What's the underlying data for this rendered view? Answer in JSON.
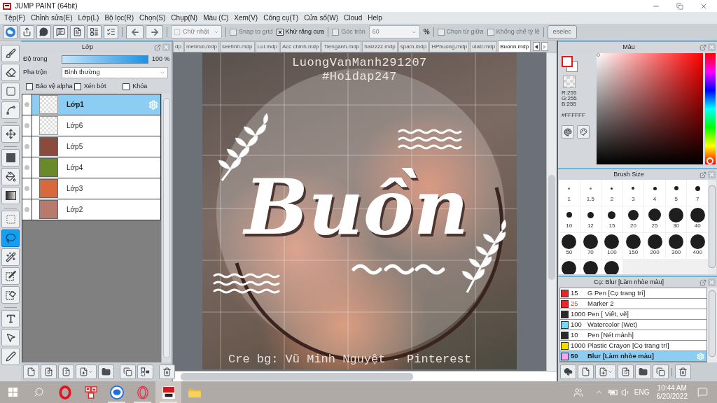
{
  "window": {
    "title": "JUMP PAINT (64bit)"
  },
  "menu": [
    "Tệp(F)",
    "Chỉnh sửa(E)",
    "Lớp(L)",
    "Bộ lọc(R)",
    "Chọn(S)",
    "Chụp(N)",
    "Màu (C)",
    "Xem(V)",
    "Công cụ(T)",
    "Cửa sổ(W)",
    "Cloud",
    "Help"
  ],
  "toolbar": {
    "button_groups": [
      [
        {
          "kind": "cloud"
        },
        {
          "kind": "share"
        },
        {
          "kind": "bubble"
        },
        {
          "kind": "comment"
        },
        {
          "kind": "document"
        },
        {
          "kind": "list"
        },
        {
          "kind": "checklist"
        }
      ],
      [
        {
          "kind": "undo"
        },
        {
          "kind": "redo"
        }
      ]
    ],
    "option_groups": [
      [
        {
          "kind": "shape-combo",
          "value": "Chữ nhật",
          "disabled": true
        }
      ],
      [
        {
          "kind": "checkbox",
          "label": "Snap to grid",
          "checked": false,
          "disabled": true
        },
        {
          "kind": "checkbox",
          "label": "Khử răng cưa",
          "checked": true,
          "disabled": false
        }
      ],
      [
        {
          "kind": "checkbox",
          "label": "Góc tròn",
          "checked": false,
          "disabled": true
        },
        {
          "kind": "combo",
          "value": "60",
          "disabled": true
        },
        {
          "kind": "text",
          "label": "%"
        }
      ],
      [
        {
          "kind": "checkbox",
          "label": "Chọn từ giữa",
          "checked": false,
          "disabled": true
        },
        {
          "kind": "checkbox",
          "label": "Khống chế tỷ lệ",
          "checked": false,
          "disabled": true
        }
      ],
      [
        {
          "kind": "button",
          "label": "eselec",
          "disabled": true
        }
      ]
    ]
  },
  "tool_groups": [
    [
      {
        "kind": "brush",
        "selected": false
      },
      {
        "kind": "eraser",
        "selected": false
      },
      {
        "kind": "rectangle",
        "selected": false
      },
      {
        "kind": "polyline",
        "selected": false
      }
    ],
    [
      {
        "kind": "move",
        "selected": false
      }
    ],
    [
      {
        "kind": "fill-rect",
        "selected": false
      },
      {
        "kind": "bucket",
        "selected": false
      },
      {
        "kind": "gradient",
        "selected": false
      }
    ],
    [
      {
        "kind": "rect-select",
        "selected": false
      },
      {
        "kind": "lasso",
        "selected": true
      },
      {
        "kind": "wand",
        "selected": false
      },
      {
        "kind": "select-pen",
        "selected": false
      },
      {
        "kind": "select-eraser",
        "selected": false
      }
    ],
    [
      {
        "kind": "text",
        "selected": false
      },
      {
        "kind": "object-select",
        "selected": false
      },
      {
        "kind": "pen",
        "selected": false
      }
    ]
  ],
  "layer_panel": {
    "title": "Lớp",
    "opacity": {
      "label": "Độ trong",
      "level": 1,
      "reading": "100 %"
    },
    "blend": {
      "label": "Pha trộn",
      "value": "Bình thường"
    },
    "options": [
      {
        "label": "Bảo vệ alpha",
        "checked": false
      },
      {
        "label": "Xén bớt",
        "checked": false
      },
      {
        "label": "Khóa",
        "checked": false
      }
    ],
    "layers": [
      {
        "kind": "transparent",
        "name": "Lớp1",
        "selected": true
      },
      {
        "kind": "transparent",
        "name": "Lớp6",
        "selected": false
      },
      {
        "kind": "photo",
        "name": "Lớp5",
        "selected": false,
        "color": "#8c4a3c"
      },
      {
        "kind": "photo",
        "name": "Lớp4",
        "selected": false,
        "color": "#6a8a2a"
      },
      {
        "kind": "photo",
        "name": "Lớp3",
        "selected": false,
        "color": "#d8683e"
      },
      {
        "kind": "photo",
        "name": "Lớp2",
        "selected": false,
        "color": "#b87a6c"
      }
    ],
    "footer_groups": [
      [
        {
          "kind": "new"
        },
        {
          "kind": "new-digit",
          "label": "8"
        },
        {
          "kind": "new-digit",
          "label": "1"
        },
        {
          "kind": "add-menu"
        },
        {
          "kind": "folder"
        }
      ],
      [
        {
          "kind": "duplicate"
        },
        {
          "kind": "merge"
        }
      ],
      [
        {
          "kind": "delete"
        }
      ]
    ]
  },
  "tabs": [
    {
      "label": "dp",
      "selected": false
    },
    {
      "label": "metmoi.mdp",
      "selected": false
    },
    {
      "label": "seetinh.mdp",
      "selected": false
    },
    {
      "label": "Lui.mdp",
      "selected": false
    },
    {
      "label": "Acc chinh.mdp",
      "selected": false
    },
    {
      "label": "Tienganh.mdp",
      "selected": false
    },
    {
      "label": "haizzzz.mdp",
      "selected": false
    },
    {
      "label": "spam.mdp",
      "selected": false
    },
    {
      "label": "HPhuong.mdp",
      "selected": false
    },
    {
      "label": "ulatr.mdp",
      "selected": false
    },
    {
      "label": "Buonn.mdp",
      "selected": true
    }
  ],
  "canvas": {
    "signature": [
      "LuongVanManh291207",
      "#Hoidap247"
    ],
    "title": "Buồn",
    "credit": "Cre bg: Vũ Minh Nguyệt - Pinterest"
  },
  "color_panel": {
    "title": "Màu",
    "channels": [
      "R:255",
      "G:255",
      "B:255"
    ],
    "hex": "#FFFFFF",
    "hue": {
      "level": 0
    }
  },
  "brush_size_panel": {
    "title": "Brush Size",
    "sizes": [
      "1",
      "1.5",
      "2",
      "3",
      "4",
      "5",
      "7",
      "10",
      "12",
      "15",
      "20",
      "25",
      "30",
      "40",
      "50",
      "70",
      "100",
      "150",
      "200",
      "300",
      "400"
    ]
  },
  "brush_panel": {
    "title": "Cọ: Blur [Làm nhòe màu]",
    "brushes": [
      {
        "color": "#e8262a",
        "size": "15",
        "name": "G Pen [Cọ trang trí]",
        "selected": false,
        "size_alert": false
      },
      {
        "color": "#e8262a",
        "size": "25",
        "name": "Marker 2",
        "selected": false,
        "size_alert": true
      },
      {
        "color": "#2a2a2e",
        "size": "1000",
        "name": "Pen [ Viết, vẽ]",
        "selected": false,
        "size_alert": false
      },
      {
        "color": "#7fd4f4",
        "size": "100",
        "name": "Watercolor (Wet)",
        "selected": false,
        "size_alert": false
      },
      {
        "color": "#2a2a2e",
        "size": "10",
        "name": "Pen [Nét mảnh]",
        "selected": false,
        "size_alert": false
      },
      {
        "color": "#f2dc00",
        "size": "1000",
        "name": "Plastic Crayon [Cọ trang trí]",
        "selected": false,
        "size_alert": false
      },
      {
        "color": "#f4a8f0",
        "size": "50",
        "name": "Blur [Làm nhòe màu]",
        "selected": true,
        "size_alert": false
      }
    ],
    "footer_groups": [
      [
        {
          "kind": "cloud-download"
        },
        {
          "kind": "new"
        },
        {
          "kind": "add-menu"
        },
        {
          "kind": "new-digit",
          "label": "S"
        },
        {
          "kind": "folder"
        },
        {
          "kind": "duplicate"
        }
      ],
      [
        {
          "kind": "delete"
        }
      ]
    ]
  },
  "taskbar": {
    "apps": [
      {
        "kind": "opera",
        "running": false,
        "selected": false
      },
      {
        "kind": "grid-app",
        "running": false,
        "selected": false
      },
      {
        "kind": "zalo",
        "running": true,
        "selected": false
      },
      {
        "kind": "opera-outline",
        "running": true,
        "selected": false
      },
      {
        "kind": "jump-paint",
        "running": true,
        "selected": true
      },
      {
        "kind": "folder",
        "running": false,
        "selected": false
      }
    ],
    "tray": {
      "language": "ENG",
      "time": "10:44 AM",
      "date": "6/20/2022"
    }
  }
}
